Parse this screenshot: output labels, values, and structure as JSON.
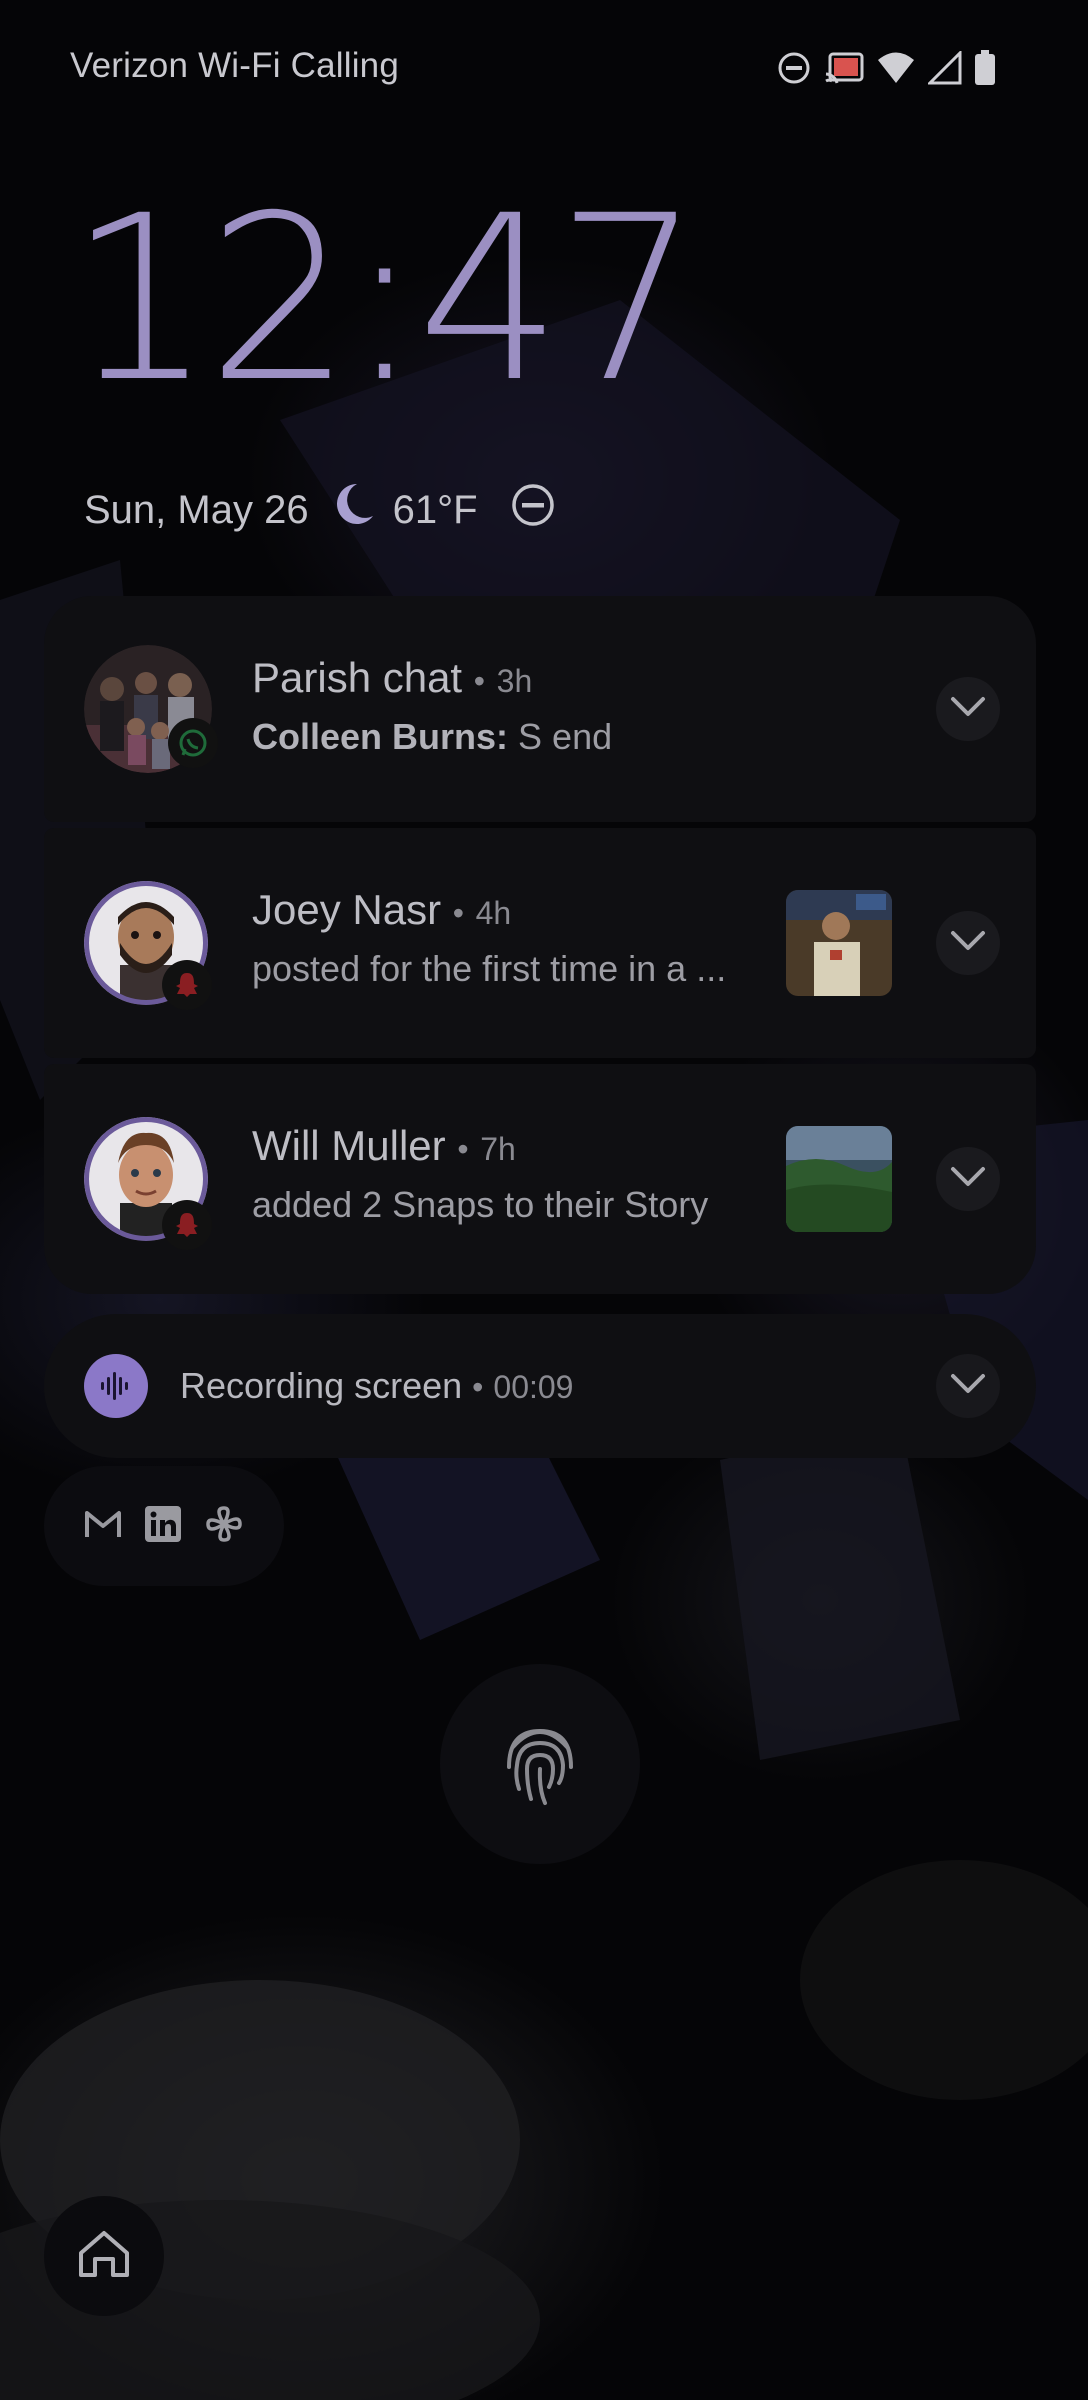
{
  "status_bar": {
    "carrier": "Verizon Wi-Fi Calling",
    "icons": [
      "do-not-disturb-icon",
      "cast-icon",
      "wifi-icon",
      "cell-signal-icon",
      "battery-icon"
    ]
  },
  "lock_screen": {
    "time": "12:47",
    "date": "Sun, May 26",
    "weather_icon": "moon-icon",
    "temperature": "61°F",
    "dnd_icon": "do-not-disturb-icon"
  },
  "notifications": [
    {
      "title": "Parish chat",
      "separator": "•",
      "time": "3h",
      "sender": "Colleen Burns:",
      "message": "S end",
      "app_badge": "whatsapp-icon"
    },
    {
      "title": "Joey Nasr",
      "separator": "•",
      "time": "4h",
      "message": "posted for the first time in a ...",
      "app_badge": "snapchat-icon"
    },
    {
      "title": "Will Muller",
      "separator": "•",
      "time": "7h",
      "message": "added 2 Snaps to their Story",
      "app_badge": "snapchat-icon"
    }
  ],
  "recording": {
    "label": "Recording screen",
    "separator": "•",
    "time": "00:09",
    "icon": "sound-wave-icon"
  },
  "app_icons": [
    "gmail-icon",
    "linkedin-icon",
    "pinwheel-icon"
  ],
  "colors": {
    "accent": "#9b8fc2",
    "card": "#0f0f12",
    "text_primary": "#bdbdc4",
    "text_secondary": "#9d9da4"
  }
}
